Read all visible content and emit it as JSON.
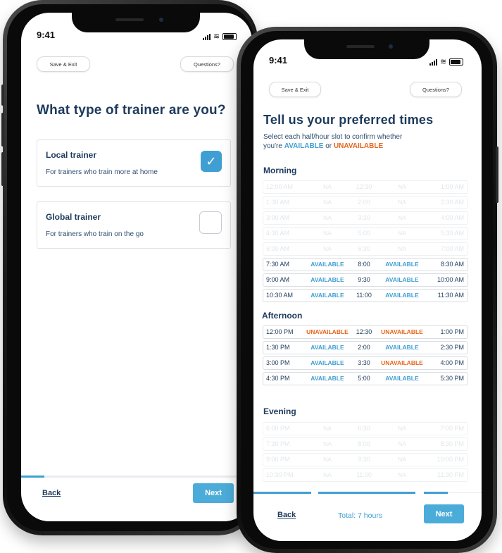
{
  "phone1": {
    "status_time": "9:41",
    "save_exit": "Save & Exit",
    "questions": "Questions?",
    "heading": "What type of trainer are you?",
    "options": [
      {
        "title": "Local trainer",
        "subtitle": "For trainers who train more at home",
        "checked": true
      },
      {
        "title": "Global trainer",
        "subtitle": "For trainers who train on the go",
        "checked": false
      }
    ],
    "checkmark": "✓",
    "back_label": "Back",
    "next_label": "Next",
    "progress": 0.1
  },
  "phone2": {
    "status_time": "9:41",
    "save_exit": "Save & Exit",
    "questions": "Questions?",
    "heading": "Tell us your preferred times",
    "subtitle_line1": "Select each half/hour slot to confirm whether",
    "subtitle_prefix": "you're",
    "available_word": "AVAILABLE",
    "or_word": "or",
    "unavailable_word": "UNAVAILABLE",
    "sections": {
      "morning": "Morning",
      "afternoon": "Afternoon",
      "evening": "Evening"
    },
    "morning_rows": [
      {
        "t1": "12:00 AM",
        "s1": "NA",
        "t2": "12:30",
        "s2": "NA",
        "t3": "1:00 AM",
        "faded": true
      },
      {
        "t1": "1:30 AM",
        "s1": "NA",
        "t2": "2:00",
        "s2": "NA",
        "t3": "2:30 AM",
        "faded": true
      },
      {
        "t1": "3:00 AM",
        "s1": "NA",
        "t2": "3:30",
        "s2": "NA",
        "t3": "4:00 AM",
        "faded": true
      },
      {
        "t1": "4:30 AM",
        "s1": "NA",
        "t2": "5:00",
        "s2": "NA",
        "t3": "5:30 AM",
        "faded": true
      },
      {
        "t1": "6:00 AM",
        "s1": "NA",
        "t2": "6:30",
        "s2": "NA",
        "t3": "7:00 AM",
        "faded": true
      },
      {
        "t1": "7:30 AM",
        "s1": "AVAILABLE",
        "t2": "8:00",
        "s2": "AVAILABLE",
        "t3": "8:30 AM",
        "faded": false
      },
      {
        "t1": "9:00 AM",
        "s1": "AVAILABLE",
        "t2": "9:30",
        "s2": "AVAILABLE",
        "t3": "10:00 AM",
        "faded": false
      },
      {
        "t1": "10:30 AM",
        "s1": "AVAILABLE",
        "t2": "11:00",
        "s2": "AVAILABLE",
        "t3": "11:30 AM",
        "faded": false
      }
    ],
    "afternoon_rows": [
      {
        "t1": "12:00 PM",
        "s1": "UNAVAILABLE",
        "t2": "12:30",
        "s2": "UNAVAILABLE",
        "t3": "1:00 PM",
        "faded": false
      },
      {
        "t1": "1:30 PM",
        "s1": "AVAILABLE",
        "t2": "2:00",
        "s2": "AVAILABLE",
        "t3": "2:30 PM",
        "faded": false
      },
      {
        "t1": "3:00 PM",
        "s1": "AVAILABLE",
        "t2": "3:30",
        "s2": "UNAVAILABLE",
        "t3": "4:00 PM",
        "faded": false
      },
      {
        "t1": "4:30 PM",
        "s1": "AVAILABLE",
        "t2": "5:00",
        "s2": "AVAILABLE",
        "t3": "5:30 PM",
        "faded": false
      }
    ],
    "evening_rows": [
      {
        "t1": "6:00 PM",
        "s1": "NA",
        "t2": "6:30",
        "s2": "NA",
        "t3": "7:00 PM",
        "faded": true
      },
      {
        "t1": "7:30 PM",
        "s1": "NA",
        "t2": "8:00",
        "s2": "NA",
        "t3": "8:30 PM",
        "faded": true
      },
      {
        "t1": "9:00 PM",
        "s1": "NA",
        "t2": "9:30",
        "s2": "NA",
        "t3": "10:00 PM",
        "faded": true
      },
      {
        "t1": "10:30 PM",
        "s1": "NA",
        "t2": "11:00",
        "s2": "NA",
        "t3": "11:30 PM",
        "faded": true
      }
    ],
    "back_label": "Back",
    "total_label": "Total: 7 hours",
    "next_label": "Next"
  },
  "colors": {
    "accent": "#3f9fd3",
    "unavailable": "#e8651a",
    "heading": "#1d3a5c"
  }
}
